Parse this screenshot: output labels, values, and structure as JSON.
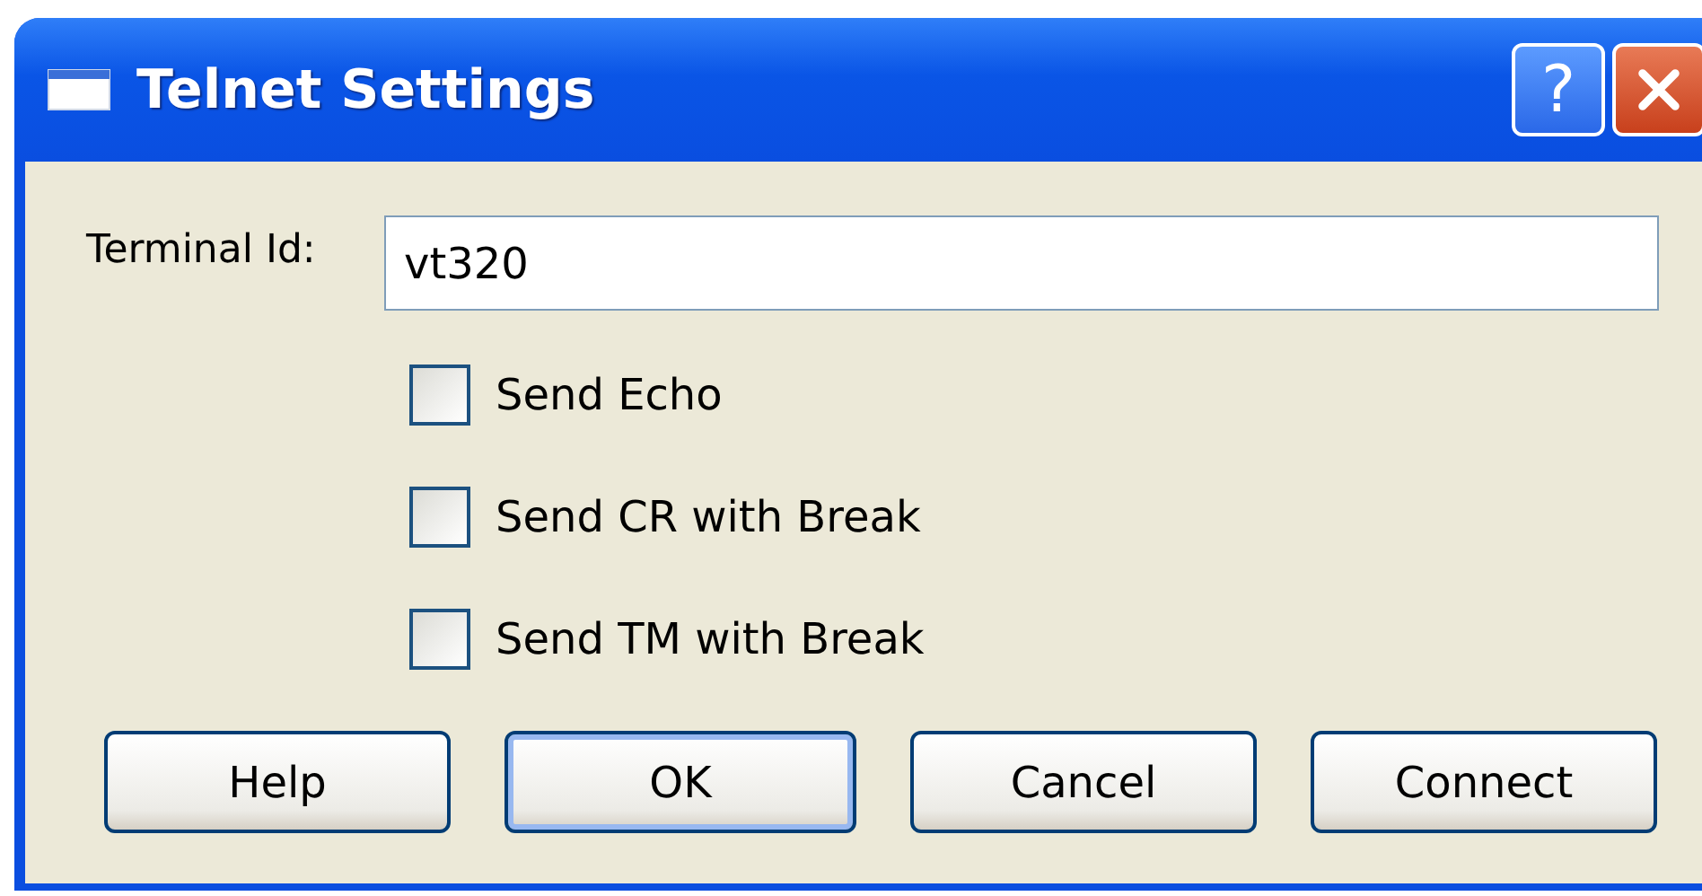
{
  "window": {
    "title": "Telnet Settings",
    "help_button": "?"
  },
  "terminal_id": {
    "label": "Terminal Id:",
    "value": "vt320"
  },
  "options": [
    {
      "label": "Send Echo",
      "checked": false
    },
    {
      "label": "Send CR with Break",
      "checked": false
    },
    {
      "label": "Send TM with Break",
      "checked": false
    }
  ],
  "buttons": [
    {
      "label": "Help",
      "default": false
    },
    {
      "label": "OK",
      "default": true
    },
    {
      "label": "Cancel",
      "default": false
    },
    {
      "label": "Connect",
      "default": false
    }
  ]
}
